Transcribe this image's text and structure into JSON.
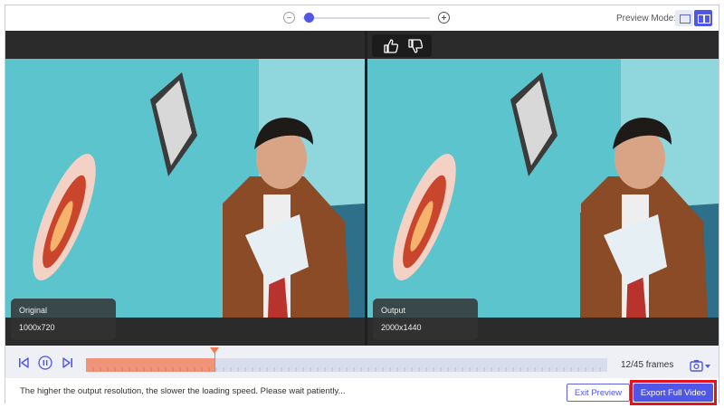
{
  "top_bar": {
    "preview_mode_label": "Preview Mode:",
    "zoom_level": 0.05
  },
  "panes": {
    "original": {
      "label": "Original",
      "resolution": "1000x720"
    },
    "output": {
      "label": "Output",
      "resolution": "2000x1440"
    }
  },
  "timeline": {
    "frames_text": "12/45 frames",
    "progress": 0.2464
  },
  "bottom_bar": {
    "hint": "The higher the output resolution, the slower the loading speed. Please wait patiently...",
    "exit_preview_label": "Exit Preview",
    "export_label": "Export Full Video"
  },
  "colors": {
    "accent": "#4f56e8",
    "progress_fill": "#ef9479",
    "playhead": "#f07b50",
    "highlight_border": "#e0141e"
  },
  "icons": {
    "zoom_out": "zoom-out-icon",
    "zoom_in": "zoom-in-icon",
    "thumbs_up": "thumbs-up-icon",
    "thumbs_down": "thumbs-down-icon",
    "previous": "previous-frame-icon",
    "pause": "pause-icon",
    "next": "next-frame-icon",
    "snapshot": "camera-icon"
  }
}
